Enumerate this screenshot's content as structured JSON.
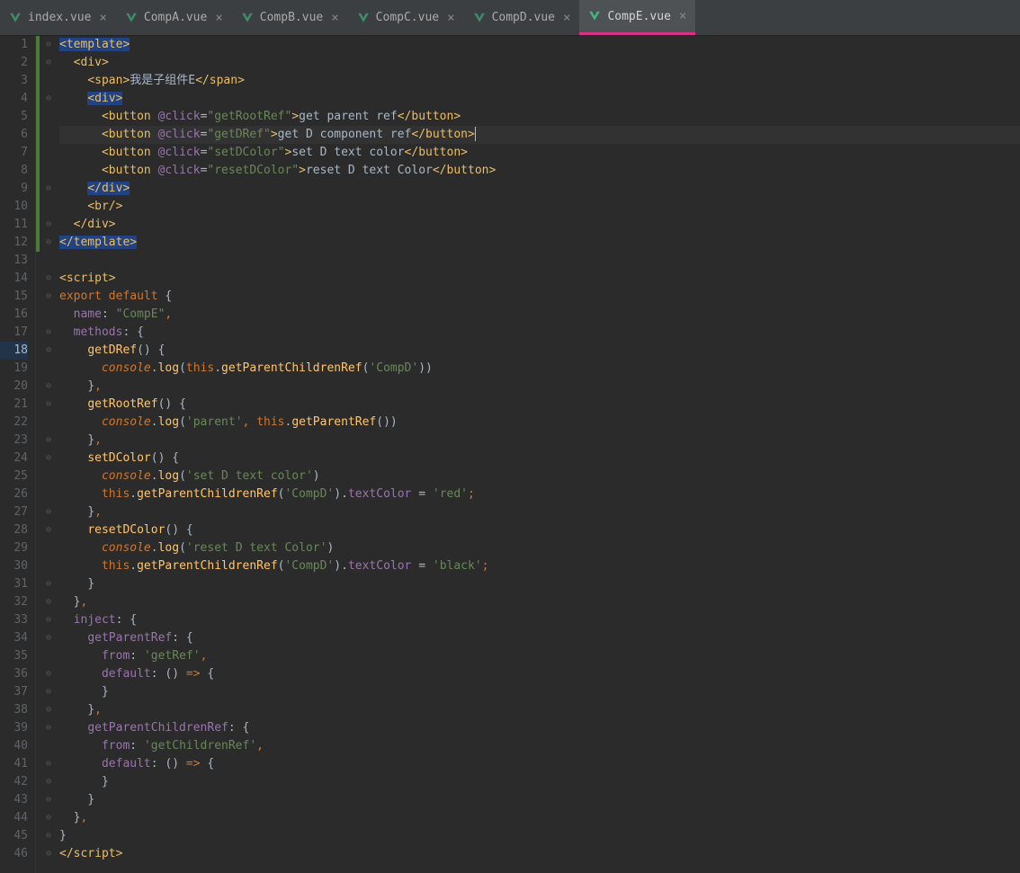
{
  "tabs": [
    {
      "label": "index.vue",
      "active": false
    },
    {
      "label": "CompA.vue",
      "active": false
    },
    {
      "label": "CompB.vue",
      "active": false
    },
    {
      "label": "CompC.vue",
      "active": false
    },
    {
      "label": "CompD.vue",
      "active": false
    },
    {
      "label": "CompE.vue",
      "active": true
    }
  ],
  "code": {
    "lines": [
      {
        "n": 1,
        "html": "<span class='sel-span'><span class='tagb'>&lt;template&gt;</span></span>",
        "change": "green"
      },
      {
        "n": 2,
        "html": "  <span class='tagb'>&lt;div&gt;</span>",
        "change": "green"
      },
      {
        "n": 3,
        "html": "    <span class='tagb'>&lt;span&gt;</span><span class='txt'>我是子组件E</span><span class='tagb'>&lt;/span&gt;</span>",
        "change": "green"
      },
      {
        "n": 4,
        "html": "    <span class='sel-span'><span class='tagb'>&lt;div&gt;</span></span>",
        "change": "green"
      },
      {
        "n": 5,
        "html": "      <span class='tagb'>&lt;button </span><span class='attr'>@click</span><span class='pun'>=</span><span class='val'>\"getRootRef\"</span><span class='tagb'>&gt;</span><span class='txt'>get parent ref</span><span class='tagb'>&lt;/button&gt;</span>",
        "change": "green"
      },
      {
        "n": 6,
        "html": "      <span class='tagb'>&lt;button </span><span class='attr'>@click</span><span class='pun'>=</span><span class='val'>\"getDRef\"</span><span class='tagb'>&gt;</span><span class='txt'>get D component ref</span><span class='tagb'>&lt;/button&gt;</span><span class='caret'></span>",
        "current": true,
        "change": "green"
      },
      {
        "n": 7,
        "html": "      <span class='tagb'>&lt;button </span><span class='attr'>@click</span><span class='pun'>=</span><span class='val'>\"setDColor\"</span><span class='tagb'>&gt;</span><span class='txt'>set D text color</span><span class='tagb'>&lt;/button&gt;</span>",
        "change": "green"
      },
      {
        "n": 8,
        "html": "      <span class='tagb'>&lt;button </span><span class='attr'>@click</span><span class='pun'>=</span><span class='val'>\"resetDColor\"</span><span class='tagb'>&gt;</span><span class='txt'>reset D text Color</span><span class='tagb'>&lt;/button&gt;</span>",
        "change": "green"
      },
      {
        "n": 9,
        "html": "    <span class='sel-span'><span class='tagb'>&lt;/div&gt;</span></span>",
        "change": "green"
      },
      {
        "n": 10,
        "html": "    <span class='tagb'>&lt;br/&gt;</span>",
        "change": "green"
      },
      {
        "n": 11,
        "html": "  <span class='tagb'>&lt;/div&gt;</span>",
        "change": "green"
      },
      {
        "n": 12,
        "html": "<span class='sel-span'><span class='tagb'>&lt;/template&gt;</span></span>",
        "change": "green"
      },
      {
        "n": 13,
        "html": " "
      },
      {
        "n": 14,
        "html": "<span class='tagb'>&lt;script&gt;</span>"
      },
      {
        "n": 15,
        "html": "<span class='kw'>export default </span><span class='pun'>{</span>"
      },
      {
        "n": 16,
        "html": "  <span class='id'>name</span><span class='pun'>: </span><span class='grn'>\"CompE\"</span><span class='kw'>,</span>"
      },
      {
        "n": 17,
        "html": "  <span class='id'>methods</span><span class='pun'>: {</span>"
      },
      {
        "n": 18,
        "html": "    <span class='fn'>getDRef</span><span class='pun'>() {</span>",
        "bp": true
      },
      {
        "n": 19,
        "html": "      <span class='ital'>console</span><span class='pun'>.</span><span class='fn'>log</span><span class='pun'>(</span><span class='kw'>this</span><span class='pun'>.</span><span class='fn'>getParentChildrenRef</span><span class='pun'>(</span><span class='grn'>'CompD'</span><span class='pun'>))</span>"
      },
      {
        "n": 20,
        "html": "    <span class='pun'>}</span><span class='kw'>,</span>"
      },
      {
        "n": 21,
        "html": "    <span class='fn'>getRootRef</span><span class='pun'>() {</span>"
      },
      {
        "n": 22,
        "html": "      <span class='ital'>console</span><span class='pun'>.</span><span class='fn'>log</span><span class='pun'>(</span><span class='grn'>'parent'</span><span class='kw'>, </span><span class='kw'>this</span><span class='pun'>.</span><span class='fn'>getParentRef</span><span class='pun'>())</span>"
      },
      {
        "n": 23,
        "html": "    <span class='pun'>}</span><span class='kw'>,</span>"
      },
      {
        "n": 24,
        "html": "    <span class='fn'>setDColor</span><span class='pun'>() {</span>"
      },
      {
        "n": 25,
        "html": "      <span class='ital'>console</span><span class='pun'>.</span><span class='fn'>log</span><span class='pun'>(</span><span class='grn'>'set D text color'</span><span class='pun'>)</span>"
      },
      {
        "n": 26,
        "html": "      <span class='kw'>this</span><span class='pun'>.</span><span class='fn'>getParentChildrenRef</span><span class='pun'>(</span><span class='grn'>'CompD'</span><span class='pun'>).</span><span class='id'>textColor</span><span class='pun'> = </span><span class='grn'>'red'</span><span class='kw'>;</span>"
      },
      {
        "n": 27,
        "html": "    <span class='pun'>}</span><span class='kw'>,</span>"
      },
      {
        "n": 28,
        "html": "    <span class='fn'>resetDColor</span><span class='pun'>() {</span>"
      },
      {
        "n": 29,
        "html": "      <span class='ital'>console</span><span class='pun'>.</span><span class='fn'>log</span><span class='pun'>(</span><span class='grn'>'reset D text Color'</span><span class='pun'>)</span>"
      },
      {
        "n": 30,
        "html": "      <span class='kw'>this</span><span class='pun'>.</span><span class='fn'>getParentChildrenRef</span><span class='pun'>(</span><span class='grn'>'CompD'</span><span class='pun'>).</span><span class='id'>textColor</span><span class='pun'> = </span><span class='grn'>'black'</span><span class='kw'>;</span>"
      },
      {
        "n": 31,
        "html": "    <span class='pun'>}</span>"
      },
      {
        "n": 32,
        "html": "  <span class='pun'>}</span><span class='kw'>,</span>"
      },
      {
        "n": 33,
        "html": "  <span class='id'>inject</span><span class='pun'>: {</span>"
      },
      {
        "n": 34,
        "html": "    <span class='id'>getParentRef</span><span class='pun'>: {</span>"
      },
      {
        "n": 35,
        "html": "      <span class='id'>from</span><span class='pun'>: </span><span class='grn'>'getRef'</span><span class='kw'>,</span>"
      },
      {
        "n": 36,
        "html": "      <span class='id'>default</span><span class='pun'>: () </span><span class='kw'>=&gt;</span><span class='pun'> {</span>"
      },
      {
        "n": 37,
        "html": "      <span class='pun'>}</span>"
      },
      {
        "n": 38,
        "html": "    <span class='pun'>}</span><span class='kw'>,</span>"
      },
      {
        "n": 39,
        "html": "    <span class='id'>getParentChildrenRef</span><span class='pun'>: {</span>"
      },
      {
        "n": 40,
        "html": "      <span class='id'>from</span><span class='pun'>: </span><span class='grn'>'getChildrenRef'</span><span class='kw'>,</span>"
      },
      {
        "n": 41,
        "html": "      <span class='id'>default</span><span class='pun'>: () </span><span class='kw'>=&gt;</span><span class='pun'> {</span>"
      },
      {
        "n": 42,
        "html": "      <span class='pun'>}</span>"
      },
      {
        "n": 43,
        "html": "    <span class='pun'>}</span>"
      },
      {
        "n": 44,
        "html": "  <span class='pun'>}</span><span class='kw'>,</span>"
      },
      {
        "n": 45,
        "html": "<span class='pun'>}</span>"
      },
      {
        "n": 46,
        "html": "<span class='tagb'>&lt;/script&gt;</span>"
      }
    ]
  }
}
